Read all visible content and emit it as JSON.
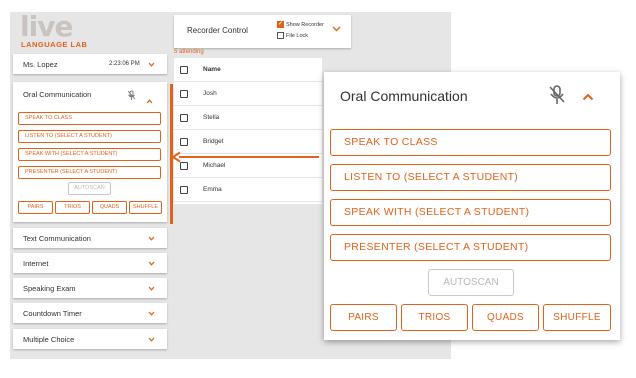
{
  "logo": {
    "word": "live",
    "sub": "LANGUAGE LAB"
  },
  "recorder": {
    "label": "Recorder Control",
    "show_recorder": {
      "label": "Show Recorder",
      "checked": true
    },
    "file_lock": {
      "label": "File Lock",
      "checked": false
    }
  },
  "teacher": {
    "name": "Ms. Lopez",
    "time": "2:23:06 PM"
  },
  "oral_small": {
    "title": "Oral Communication",
    "buttons": [
      "SPEAK TO CLASS",
      "LISTEN TO (SELECT A STUDENT)",
      "SPEAK WITH (SELECT A STUDENT)",
      "PRESENTER (SELECT A STUDENT)"
    ],
    "autoscan": "AUTOSCAN",
    "groups": [
      "PAIRS",
      "TRIOS",
      "QUADS",
      "SHUFFLE"
    ]
  },
  "sections": [
    "Text Communication",
    "Internet",
    "Speaking Exam",
    "Countdown Timer",
    "Multiple Choice"
  ],
  "roster": {
    "attending": "5 attending",
    "header": "Name",
    "students": [
      "Josh",
      "Stella",
      "Bridget",
      "Michael",
      "Emma"
    ]
  },
  "oral_big": {
    "title": "Oral Communication",
    "buttons": [
      "SPEAK TO CLASS",
      "LISTEN TO (SELECT A STUDENT)",
      "SPEAK WITH (SELECT A STUDENT)",
      "PRESENTER (SELECT A STUDENT)"
    ],
    "autoscan": "AUTOSCAN",
    "groups": [
      "PAIRS",
      "TRIOS",
      "QUADS",
      "SHUFFLE"
    ]
  },
  "colors": {
    "accent": "#e2621b",
    "background": "#e6e6e6",
    "disabled": "#c9c9c9"
  },
  "icons": {
    "mic": "mic-off-icon",
    "expand": "chevron-down-icon",
    "collapse": "chevron-up-icon",
    "arrow": "arrow-left-icon"
  }
}
